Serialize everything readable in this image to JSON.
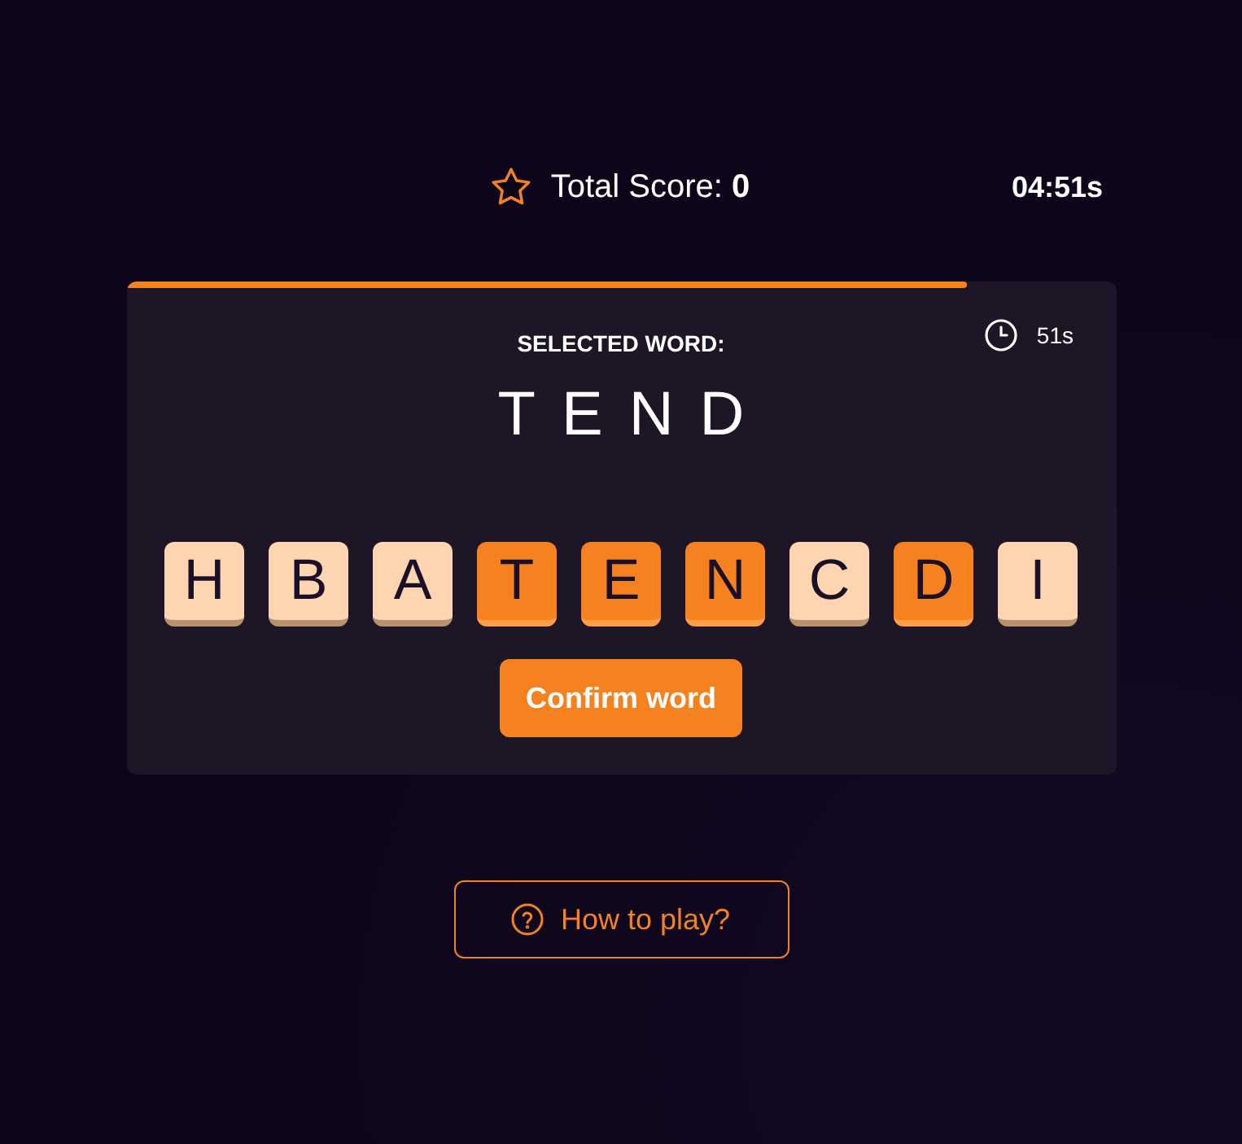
{
  "header": {
    "score_text": "Total Score: **0**",
    "time_left": "04:51s"
  },
  "round": {
    "level": 0.85,
    "label": "SELECTED WORD:",
    "timer": "51s",
    "selected_word": "TEND"
  },
  "tiles": [
    {
      "letter": "H",
      "selected": false
    },
    {
      "letter": "B",
      "selected": false
    },
    {
      "letter": "A",
      "selected": false
    },
    {
      "letter": "T",
      "selected": true
    },
    {
      "letter": "E",
      "selected": true
    },
    {
      "letter": "N",
      "selected": true
    },
    {
      "letter": "C",
      "selected": false
    },
    {
      "letter": "D",
      "selected": true
    },
    {
      "letter": "I",
      "selected": false
    }
  ],
  "confirm_button": "Confirm word",
  "help_button": "How to play?"
}
